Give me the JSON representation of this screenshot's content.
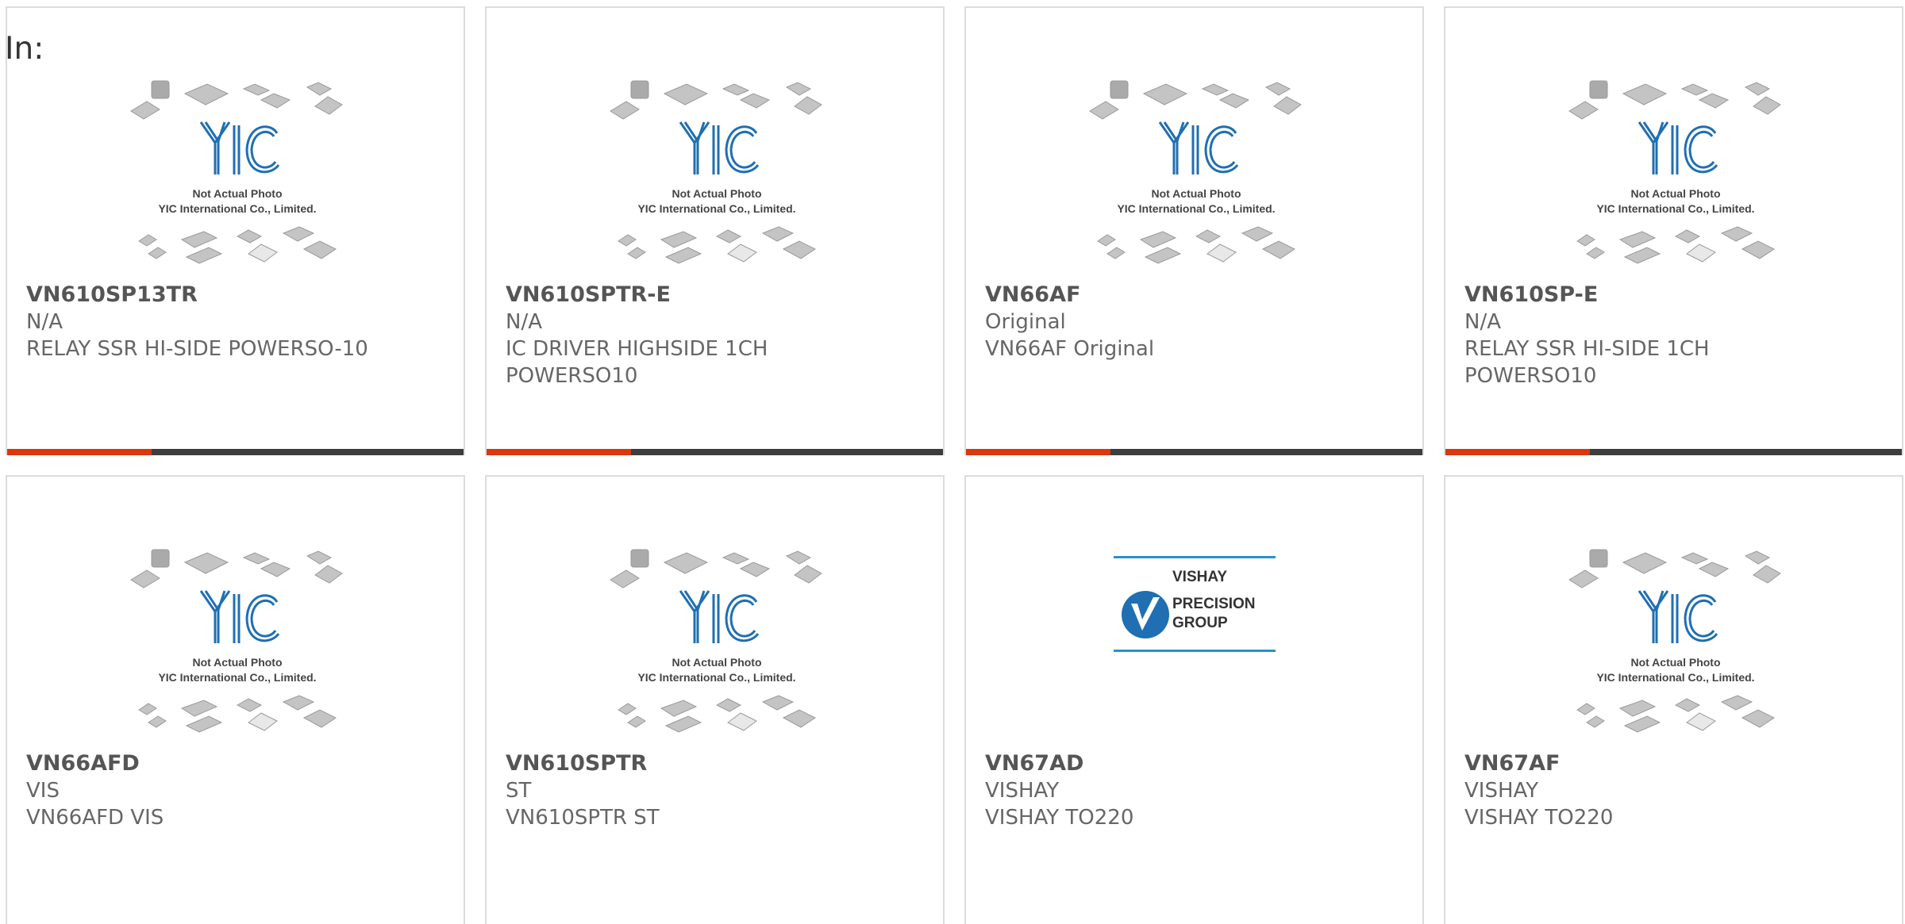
{
  "page": {
    "label": "In:"
  },
  "placeholder_image": {
    "line1": "Not Actual Photo",
    "line2": "YIC International Co., Limited.",
    "logo": "YIC"
  },
  "vishay_logo": {
    "line1": "VISHAY",
    "line2": "PRECISION",
    "line3": "GROUP"
  },
  "colors": {
    "accent": "#d9380c",
    "bar": "#3d3d3d",
    "logo_blue": "#1f6fb2",
    "text": "#666666"
  },
  "products": [
    {
      "part": "VN610SP13TR",
      "manufacturer": "N/A",
      "description": "RELAY SSR HI-SIDE POWERSO-10",
      "image": "placeholder"
    },
    {
      "part": "VN610SPTR-E",
      "manufacturer": "N/A",
      "description": "IC DRIVER HIGHSIDE 1CH POWERSO10",
      "image": "placeholder"
    },
    {
      "part": "VN66AF",
      "manufacturer": "Original",
      "description": "VN66AF Original",
      "image": "placeholder"
    },
    {
      "part": "VN610SP-E",
      "manufacturer": "N/A",
      "description": "RELAY SSR HI-SIDE 1CH POWERSO10",
      "image": "placeholder"
    },
    {
      "part": "VN66AFD",
      "manufacturer": "VIS",
      "description": "VN66AFD VIS",
      "image": "placeholder"
    },
    {
      "part": "VN610SPTR",
      "manufacturer": "ST",
      "description": "VN610SPTR ST",
      "image": "placeholder"
    },
    {
      "part": "VN67AD",
      "manufacturer": "VISHAY",
      "description": "VISHAY TO220",
      "image": "vishay"
    },
    {
      "part": "VN67AF",
      "manufacturer": "VISHAY",
      "description": "VISHAY TO220",
      "image": "placeholder"
    }
  ]
}
